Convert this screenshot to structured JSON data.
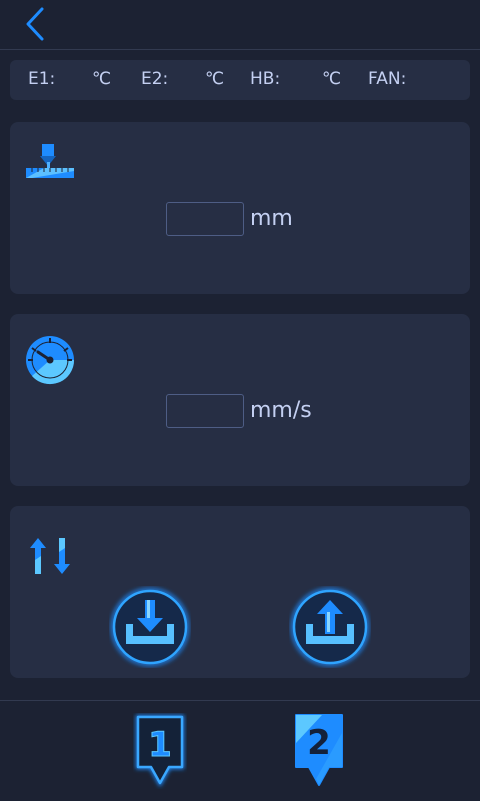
{
  "nav": {
    "back_icon": "chevron-left-icon"
  },
  "status": {
    "e1_label": "E1:",
    "e1_unit": "℃",
    "e2_label": "E2:",
    "e2_unit": "℃",
    "hb_label": "HB:",
    "hb_unit": "℃",
    "fan_label": "FAN:"
  },
  "distance": {
    "icon": "extruder-ruler-icon",
    "value": "",
    "unit": "mm"
  },
  "speed": {
    "icon": "speedometer-icon",
    "value": "",
    "unit": "mm/s"
  },
  "extrude": {
    "icon": "up-down-arrows-icon",
    "load_icon": "filament-load-icon",
    "unload_icon": "filament-unload-icon"
  },
  "tools": [
    {
      "label": "1",
      "state": "outline"
    },
    {
      "label": "2",
      "state": "filled"
    }
  ],
  "colors": {
    "accent": "#1e8cff",
    "background": "#1c2233",
    "panel": "#262e44",
    "text": "#c4d0f2"
  }
}
